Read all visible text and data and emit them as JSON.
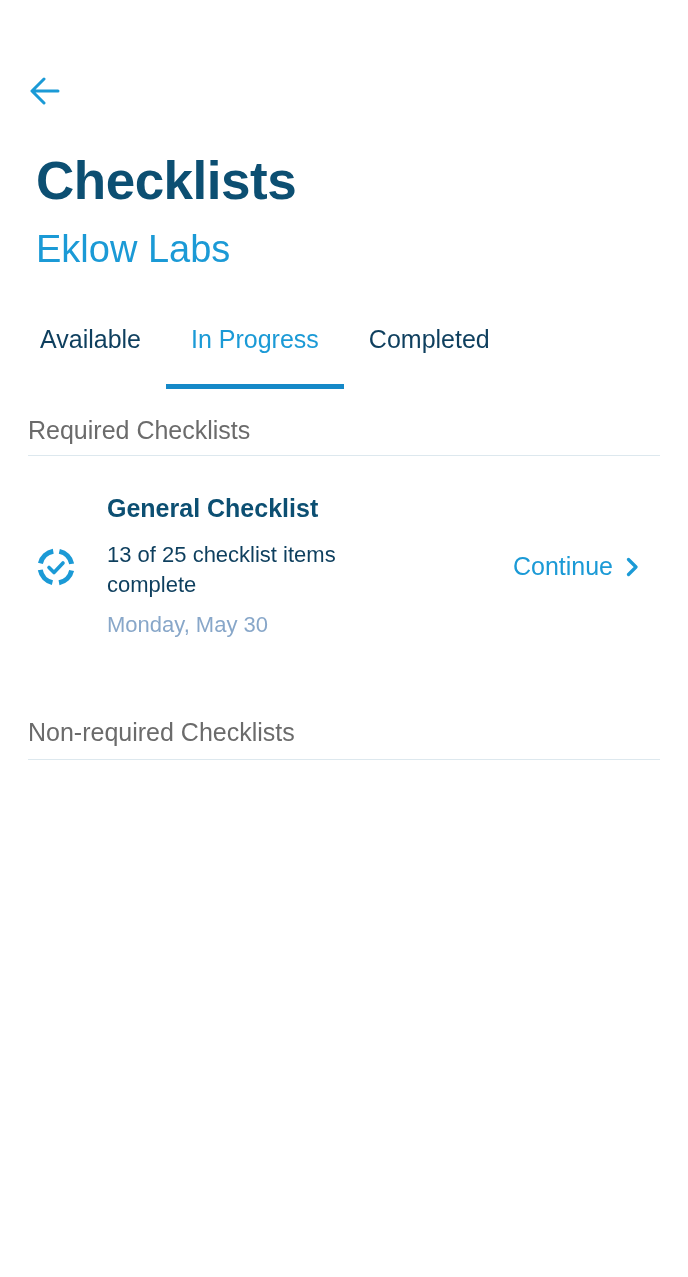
{
  "title": "Checklists",
  "subtitle": "Eklow Labs",
  "tabs": [
    {
      "label": "Available",
      "selected": false
    },
    {
      "label": "In Progress",
      "selected": true
    },
    {
      "label": "Completed",
      "selected": false
    }
  ],
  "sections": [
    {
      "heading": "Required Checklists",
      "items": [
        {
          "title": "General Checklist",
          "progress": "13 of 25 checklist items complete",
          "date": "Monday, May 30",
          "action": "Continue"
        }
      ]
    },
    {
      "heading": "Non-required Checklists"
    }
  ]
}
